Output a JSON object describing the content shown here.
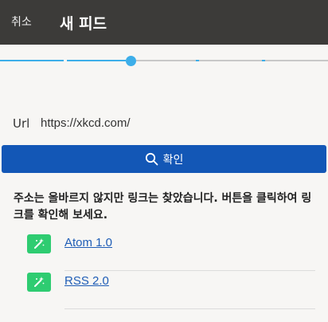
{
  "appbar": {
    "cancel_label": "취소",
    "title": "새 피드"
  },
  "progress": {
    "step_fraction": 0.4,
    "accent_color": "#3daee9"
  },
  "form": {
    "url_label": "Url",
    "url_value": "https://xkcd.com/",
    "confirm_label": "확인"
  },
  "message": "주소는 올바르지 않지만 링크는 찾았습니다. 버튼을 클릭하여 링크를 확인해 보세요.",
  "feeds": [
    {
      "label": "Atom 1.0",
      "icon": "magic-wand-icon"
    },
    {
      "label": "RSS 2.0",
      "icon": "magic-wand-icon"
    }
  ]
}
